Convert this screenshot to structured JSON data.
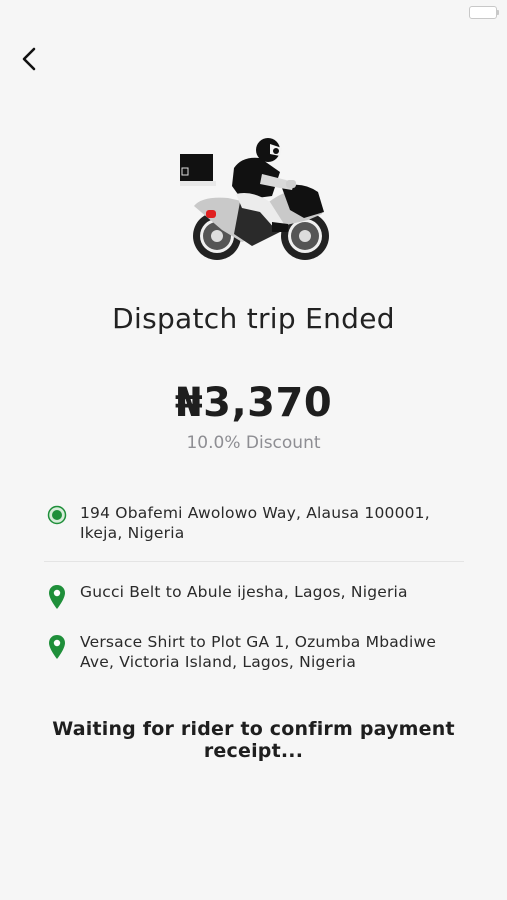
{
  "header": {
    "back_icon": "chevron-left-icon"
  },
  "hero": {
    "illustration": "delivery-rider-illustration"
  },
  "trip": {
    "title": "Dispatch trip Ended",
    "amount": "₦3,370",
    "discount": "10.0% Discount"
  },
  "stops": {
    "origin": {
      "address": "194 Obafemi Awolowo Way, Alausa 100001, Ikeja, Nigeria",
      "icon": "origin-dot-icon"
    },
    "destinations": [
      {
        "address": "Gucci Belt to Abule ijesha, Lagos, Nigeria",
        "icon": "location-pin-icon"
      },
      {
        "address": "Versace Shirt to Plot GA 1, Ozumba Mbadiwe Ave, Victoria Island, Lagos, Nigeria",
        "icon": "location-pin-icon"
      }
    ]
  },
  "status": {
    "message": "Waiting for rider to confirm payment receipt..."
  },
  "colors": {
    "accent_green": "#1f8f3a",
    "background": "#f6f6f6"
  }
}
